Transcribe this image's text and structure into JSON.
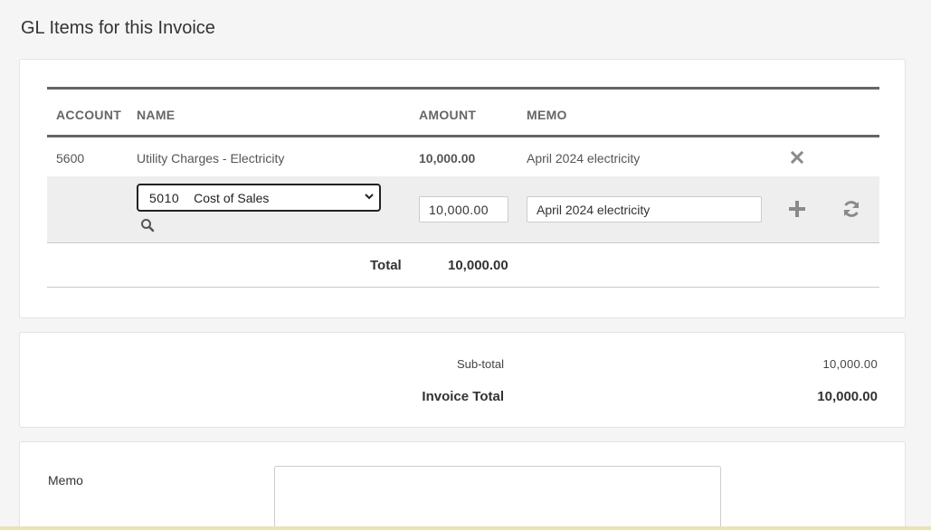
{
  "page": {
    "title": "GL Items for this Invoice"
  },
  "gl_table": {
    "columns": {
      "account": "ACCOUNT",
      "name": "NAME",
      "amount": "AMOUNT",
      "memo": "MEMO"
    },
    "rows": [
      {
        "account": "5600",
        "name": "Utility Charges - Electricity",
        "amount": "10,000.00",
        "memo": "April 2024 electricity"
      }
    ],
    "edit_row": {
      "account_code": "5010",
      "account_name": "Cost of Sales",
      "amount_value": "10,000.00",
      "memo_value": "April 2024 electricity"
    },
    "total_label": "Total",
    "total_value": "10,000.00"
  },
  "totals": {
    "subtotal_label": "Sub-total",
    "subtotal_value": "10,000.00",
    "invoice_total_label": "Invoice Total",
    "invoice_total_value": "10,000.00"
  },
  "memo_section": {
    "label": "Memo",
    "value": ""
  },
  "icons": {
    "remove": "close-icon",
    "search": "search-icon",
    "add": "plus-icon",
    "refresh": "refresh-icon",
    "dropdown": "chevron-down-icon"
  },
  "colors": {
    "icon_gray": "#8a8a8a",
    "header_rule": "#666666",
    "edit_row_bg": "#eeeeee"
  }
}
